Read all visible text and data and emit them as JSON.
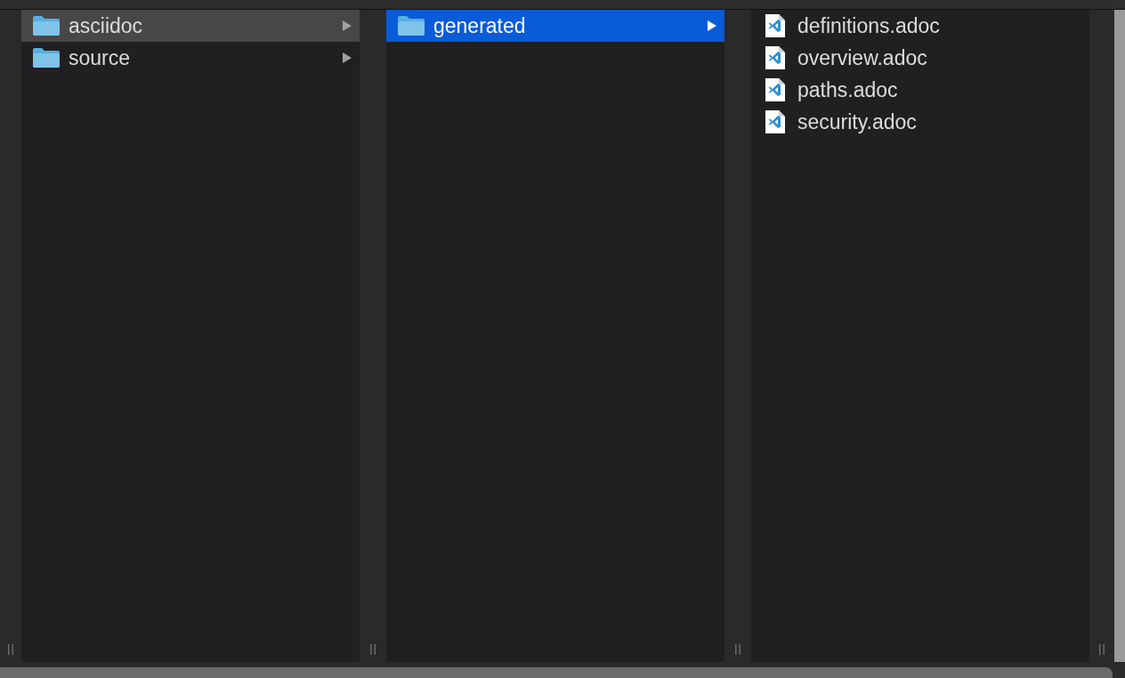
{
  "columns": [
    {
      "focused": false,
      "items": [
        {
          "kind": "folder",
          "name": "asciidoc",
          "selected": true,
          "has_children": true
        },
        {
          "kind": "folder",
          "name": "source",
          "selected": false,
          "has_children": true
        }
      ]
    },
    {
      "focused": true,
      "items": [
        {
          "kind": "folder",
          "name": "generated",
          "selected": true,
          "has_children": true
        }
      ]
    },
    {
      "items": [
        {
          "kind": "file",
          "name": "definitions.adoc",
          "selected": false,
          "has_children": false
        },
        {
          "kind": "file",
          "name": "overview.adoc",
          "selected": false,
          "has_children": false
        },
        {
          "kind": "file",
          "name": "paths.adoc",
          "selected": false,
          "has_children": false
        },
        {
          "kind": "file",
          "name": "security.adoc",
          "selected": false,
          "has_children": false
        }
      ]
    }
  ]
}
